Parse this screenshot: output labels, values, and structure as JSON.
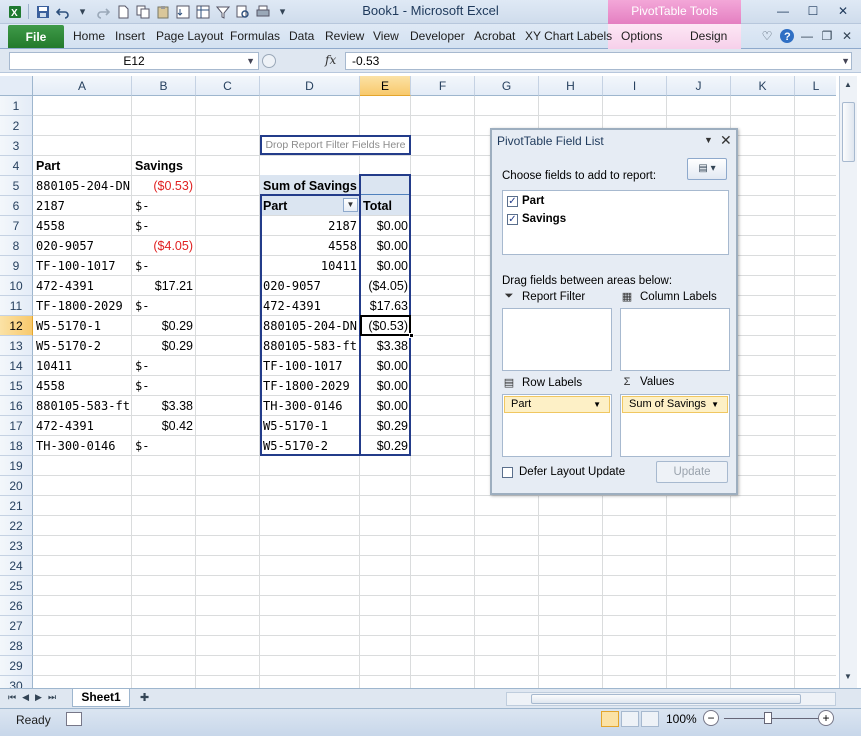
{
  "window": {
    "title": "Book1  -  Microsoft Excel",
    "contextual_tab_group": "PivotTable Tools"
  },
  "ribbon": {
    "file_tab": "File",
    "tabs": [
      "Home",
      "Insert",
      "Page Layout",
      "Formulas",
      "Data",
      "Review",
      "View",
      "Developer",
      "Acrobat",
      "XY Chart Labels",
      "Options",
      "Design"
    ]
  },
  "formula_bar": {
    "name_box": "E12",
    "fx_label": "fx",
    "formula": "-0.53"
  },
  "grid": {
    "columns": [
      "A",
      "B",
      "C",
      "D",
      "E",
      "F",
      "G",
      "H",
      "I",
      "J",
      "K",
      "L"
    ],
    "active_column": "E",
    "rows": [
      "1",
      "2",
      "3",
      "4",
      "5",
      "6",
      "7",
      "8",
      "9",
      "10",
      "11",
      "12",
      "13",
      "14",
      "15",
      "16",
      "17",
      "18",
      "19",
      "20",
      "21",
      "22",
      "23",
      "24",
      "25",
      "26",
      "27",
      "28",
      "29",
      "30"
    ],
    "active_row": "12",
    "source_header": {
      "part": "Part",
      "savings": "Savings"
    },
    "source_rows": [
      {
        "part": "880105-204-DN",
        "savings": "($0.53)",
        "negative": true
      },
      {
        "part": "2187",
        "savings": "$-",
        "dash": true
      },
      {
        "part": "4558",
        "savings": "$-",
        "dash": true
      },
      {
        "part": "020-9057",
        "savings": "($4.05)",
        "negative": true
      },
      {
        "part": "TF-100-1017",
        "savings": "$-",
        "dash": true
      },
      {
        "part": "472-4391",
        "savings": "$17.21"
      },
      {
        "part": "TF-1800-2029",
        "savings": "$-",
        "dash": true
      },
      {
        "part": "W5-5170-1",
        "savings": "$0.29"
      },
      {
        "part": "W5-5170-2",
        "savings": "$0.29"
      },
      {
        "part": "10411",
        "savings": "$-",
        "dash": true
      },
      {
        "part": "4558",
        "savings": "$-",
        "dash": true
      },
      {
        "part": "880105-583-ft",
        "savings": "$3.38"
      },
      {
        "part": "472-4391",
        "savings": "$0.42"
      },
      {
        "part": "TH-300-0146",
        "savings": "$-",
        "dash": true
      }
    ],
    "pivot": {
      "filter_placeholder": "Drop Report Filter Fields Here",
      "value_title": "Sum of Savings",
      "row_header": "Part",
      "total_header": "Total",
      "rows": [
        {
          "label": "2187",
          "total": "$0.00",
          "numeric": true
        },
        {
          "label": "4558",
          "total": "$0.00",
          "numeric": true
        },
        {
          "label": "10411",
          "total": "$0.00",
          "numeric": true
        },
        {
          "label": "020-9057",
          "total": "($4.05)"
        },
        {
          "label": "472-4391",
          "total": "$17.63"
        },
        {
          "label": "880105-204-DN",
          "total": "($0.53)"
        },
        {
          "label": "880105-583-ft",
          "total": "$3.38"
        },
        {
          "label": "TF-100-1017",
          "total": "$0.00"
        },
        {
          "label": "TF-1800-2029",
          "total": "$0.00"
        },
        {
          "label": "TH-300-0146",
          "total": "$0.00"
        },
        {
          "label": "W5-5170-1",
          "total": "$0.29"
        },
        {
          "label": "W5-5170-2",
          "total": "$0.29"
        }
      ]
    }
  },
  "field_list": {
    "title": "PivotTable Field List",
    "choose_label": "Choose fields to add to report:",
    "fields": [
      {
        "name": "Part",
        "checked": true
      },
      {
        "name": "Savings",
        "checked": true
      }
    ],
    "drag_label": "Drag fields between areas below:",
    "areas": {
      "report_filter": "Report Filter",
      "column_labels": "Column Labels",
      "row_labels": "Row Labels",
      "values": "Values"
    },
    "row_item": "Part",
    "value_item": "Sum of Savings",
    "defer_label": "Defer Layout Update",
    "update_button": "Update"
  },
  "sheet_tabs": [
    "Sheet1"
  ],
  "status_bar": {
    "ready": "Ready",
    "zoom": "100%"
  },
  "colors": {
    "negative": "#e02020",
    "pivot_border": "#233c8a",
    "pivot_header_fill": "#dbe5f1",
    "active_header": "#f8c96c",
    "file_tab": "#2a8a33",
    "contextual_tab": "#e47fc1"
  }
}
